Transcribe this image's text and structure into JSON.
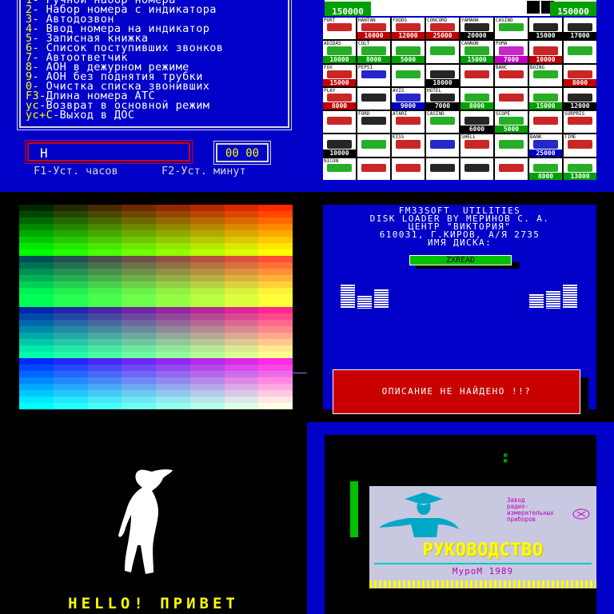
{
  "phone_menu": {
    "items": [
      {
        "key": "1",
        "text": "- Ручной набор номера"
      },
      {
        "key": "2",
        "text": "- Набор номера с индикатора"
      },
      {
        "key": "3",
        "text": "- Автодозвон"
      },
      {
        "key": "4",
        "text": "- Ввод номера на индикатор"
      },
      {
        "key": "5",
        "text": "- Записная книжка"
      },
      {
        "key": "6",
        "text": "- Список поступивших звонков"
      },
      {
        "key": "7",
        "text": "- Автоответчик"
      },
      {
        "key": "8",
        "text": "- АОН в дежурном режиме"
      },
      {
        "key": "9",
        "text": "- АОН без поднятия трубки"
      },
      {
        "key": "0",
        "text": "- Очистка списка звонивших"
      },
      {
        "key": "F3",
        "text": "-Длина номера АТС"
      },
      {
        "key": "ус",
        "text": "-Возврат в основной режим"
      },
      {
        "key": "ус+С",
        "text": "-Выход в ДОС"
      }
    ],
    "entry_value": "Н",
    "clock_value": "00 00",
    "hint_left": "F1-Уст. часов",
    "hint_right": "F2-Уст. минут"
  },
  "casino": {
    "left_money": "150000",
    "right_money": "150000",
    "cells": [
      {
        "name": "PORT",
        "price": "",
        "color": "#c00000"
      },
      {
        "name": "HANTAN",
        "price": "16000",
        "color": "#c00000"
      },
      {
        "name": "FOODS",
        "price": "12000",
        "color": "#c00000"
      },
      {
        "name": "CONCORD",
        "price": "25000",
        "color": "#c00000"
      },
      {
        "name": "YAMAHA",
        "price": "20000",
        "color": "#000000"
      },
      {
        "name": "CASINO",
        "price": "",
        "color": "#00a000"
      },
      {
        "name": "",
        "price": "15000",
        "color": "#000000"
      },
      {
        "name": "",
        "price": "17000",
        "color": "#000000"
      },
      {
        "name": "ADIDAS",
        "price": "10000",
        "color": "#00a000"
      },
      {
        "name": "COLT",
        "price": "8000",
        "color": "#00a000"
      },
      {
        "name": "",
        "price": "5000",
        "color": "#00a000"
      },
      {
        "name": "",
        "price": "",
        "color": "#00a000"
      },
      {
        "name": "CANNON",
        "price": "15000",
        "color": "#00a000"
      },
      {
        "name": "PUMA",
        "price": "7000",
        "color": "#c000c0"
      },
      {
        "name": "",
        "price": "10000",
        "color": "#c00000"
      },
      {
        "name": "",
        "price": "",
        "color": "#00a000"
      },
      {
        "name": "FOX",
        "price": "15000",
        "color": "#c00000"
      },
      {
        "name": "PEPSI",
        "price": "",
        "color": "#0000c0"
      },
      {
        "name": "",
        "price": "",
        "color": "#00a000"
      },
      {
        "name": "",
        "price": "18000",
        "color": "#000000"
      },
      {
        "name": "",
        "price": "",
        "color": "#c00000"
      },
      {
        "name": "BANC",
        "price": "",
        "color": "#c00000"
      },
      {
        "name": "BOING",
        "price": "",
        "color": "#00a000"
      },
      {
        "name": "",
        "price": "8000",
        "color": "#c00000"
      },
      {
        "name": "PLAY",
        "price": "8000",
        "color": "#c00000"
      },
      {
        "name": "",
        "price": "",
        "color": "#000000"
      },
      {
        "name": "AVIS",
        "price": "9000",
        "color": "#0000c0"
      },
      {
        "name": "HOTEL",
        "price": "7000",
        "color": "#000000"
      },
      {
        "name": "",
        "price": "8000",
        "color": "#00a000"
      },
      {
        "name": "",
        "price": "",
        "color": "#c00000"
      },
      {
        "name": "",
        "price": "15000",
        "color": "#00a000"
      },
      {
        "name": "",
        "price": "12000",
        "color": "#000000"
      },
      {
        "name": "",
        "price": "",
        "color": "#c00000"
      },
      {
        "name": "FORD",
        "price": "",
        "color": "#000000"
      },
      {
        "name": "ATARI",
        "price": "",
        "color": "#c00000"
      },
      {
        "name": "CASINO",
        "price": "",
        "color": "#00a000"
      },
      {
        "name": "",
        "price": "6000",
        "color": "#000000"
      },
      {
        "name": "SCOPE",
        "price": "5000",
        "color": "#00a000"
      },
      {
        "name": "",
        "price": "",
        "color": "#c00000"
      },
      {
        "name": "SURPRIS",
        "price": "",
        "color": "#c00000"
      },
      {
        "name": "",
        "price": "10000",
        "color": "#000000"
      },
      {
        "name": "",
        "price": "",
        "color": "#00a000"
      },
      {
        "name": "KISS",
        "price": "",
        "color": "#c00000"
      },
      {
        "name": "",
        "price": "",
        "color": "#0000c0"
      },
      {
        "name": "SHELL",
        "price": "",
        "color": "#c00000"
      },
      {
        "name": "",
        "price": "",
        "color": "#00a000"
      },
      {
        "name": "BANK",
        "price": "25000",
        "color": "#0000c0"
      },
      {
        "name": "TIME",
        "price": "",
        "color": "#c00000"
      },
      {
        "name": "NICON",
        "price": "",
        "color": "#00a000"
      },
      {
        "name": "",
        "price": "",
        "color": "#c00000"
      },
      {
        "name": "",
        "price": "",
        "color": "#c00000"
      },
      {
        "name": "",
        "price": "",
        "color": "#000000"
      },
      {
        "name": "",
        "price": "",
        "color": "#000000"
      },
      {
        "name": "",
        "price": "",
        "color": "#c00000"
      },
      {
        "name": "",
        "price": "8000",
        "color": "#00a000"
      },
      {
        "name": "",
        "price": "13000",
        "color": "#00a000"
      }
    ]
  },
  "loader": {
    "line1": "FM33SOFT  UTILITIES",
    "line2": "DISK LOADER BY МЕРИНОВ С. А.",
    "line3": "ЦЕНТР \"ВИКТОРИЯ\"",
    "line4": "610031, Г.КИРОВ, А/Я 2735",
    "line5": "ИМЯ ДИСКА:",
    "disk_name": "ZXREAD",
    "error": "ОПИСАНИЕ НЕ НАЙДЕНО !!?"
  },
  "hello": {
    "text": "HELLO! ПРИВЕТ"
  },
  "manual": {
    "plant": "Завод\nрадио-\nизмерительных\nприборов",
    "title": "РУКОВОДСТВО",
    "city": "МуроМ 1989"
  }
}
